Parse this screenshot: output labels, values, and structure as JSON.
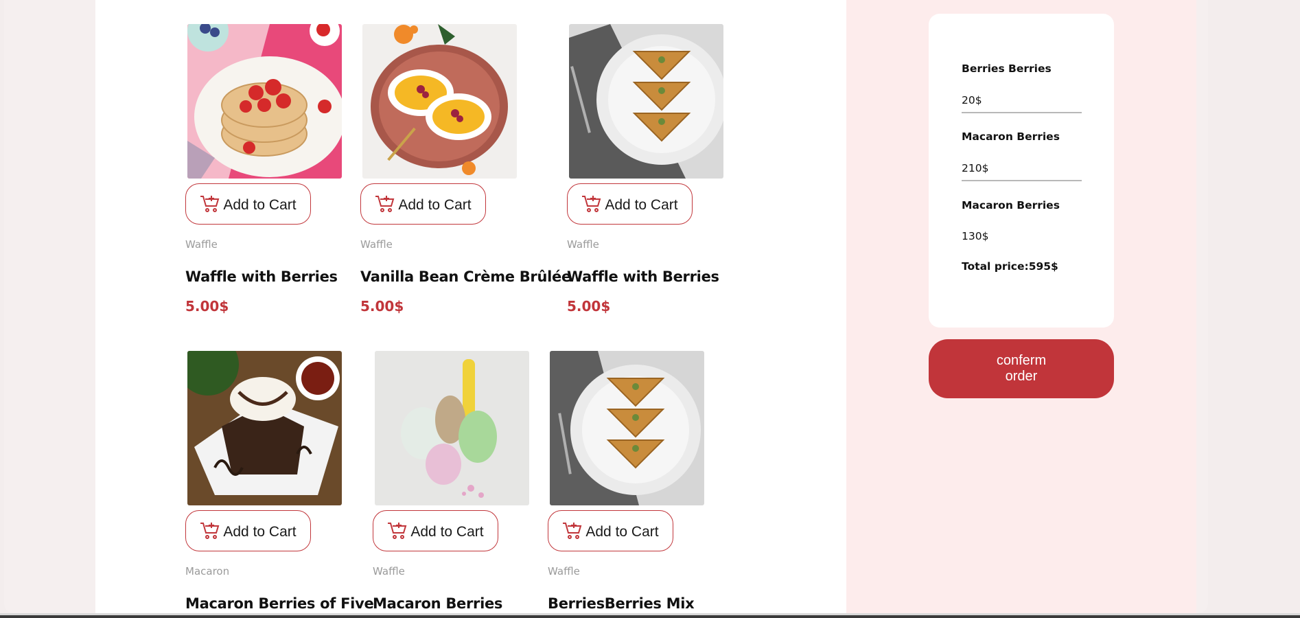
{
  "products": [
    {
      "category": "Waffle",
      "title": "Waffle with Berries",
      "price": "5.00$",
      "button_label": "Add to Cart"
    },
    {
      "category": "Waffle",
      "title": "Vanilla Bean Crème Brûlée",
      "price": "5.00$",
      "button_label": "Add to Cart"
    },
    {
      "category": "Waffle",
      "title": "Waffle with Berries",
      "price": "5.00$",
      "button_label": "Add to Cart"
    },
    {
      "category": "Macaron",
      "title": "Macaron Berries of Five",
      "price": "",
      "button_label": "Add to Cart"
    },
    {
      "category": "Waffle",
      "title": "Macaron Berries",
      "price": "",
      "button_label": "Add to Cart"
    },
    {
      "category": "Waffle",
      "title": "BerriesBerries Mix",
      "price": "",
      "button_label": "Add to Cart"
    }
  ],
  "cart": {
    "items": [
      {
        "name": "Berries Berries",
        "price": "20$"
      },
      {
        "name": "Macaron Berries",
        "price": "210$"
      },
      {
        "name": "Macaron Berries",
        "price": "130$"
      }
    ],
    "total": "Total price:595$",
    "confirm_label": "conferm order"
  },
  "colors": {
    "accent": "#c1353a",
    "sidebar_bg": "#fdecec",
    "page_bg": "#f5efef"
  }
}
